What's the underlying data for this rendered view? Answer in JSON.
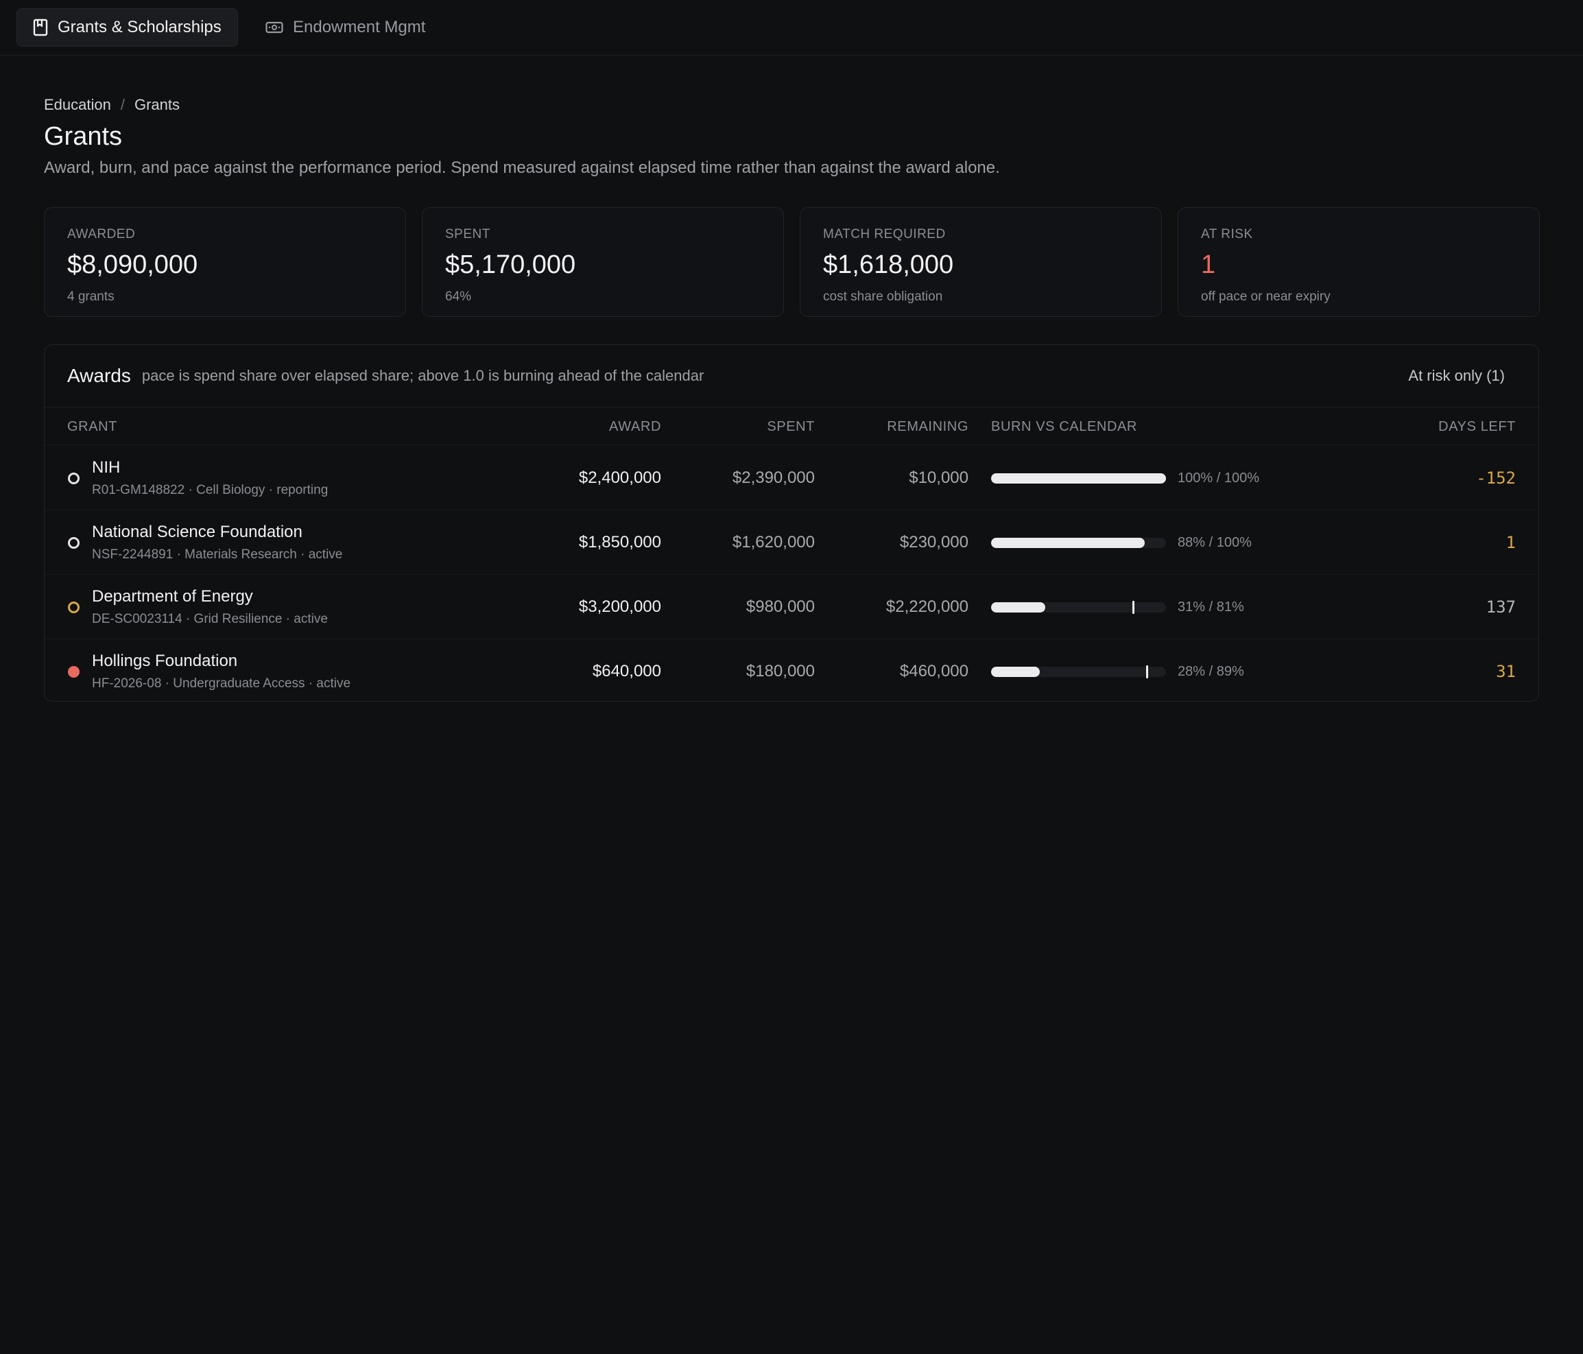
{
  "tabs": [
    {
      "label": "Grants & Scholarships",
      "icon": "bookmark-book-icon",
      "active": true
    },
    {
      "label": "Endowment Mgmt",
      "icon": "banknote-icon",
      "active": false
    }
  ],
  "breadcrumb": {
    "parent": "Education",
    "separator": "/",
    "current": "Grants"
  },
  "page": {
    "title": "Grants",
    "subtitle": "Award, burn, and pace against the performance period. Spend measured against elapsed time rather than against the award alone."
  },
  "kpis": [
    {
      "label": "AWARDED",
      "value": "$8,090,000",
      "sub": "4 grants"
    },
    {
      "label": "SPENT",
      "value": "$5,170,000",
      "sub": "64%"
    },
    {
      "label": "MATCH REQUIRED",
      "value": "$1,618,000",
      "sub": "cost share obligation"
    },
    {
      "label": "AT RISK",
      "value": "1",
      "sub": "off pace or near expiry"
    }
  ],
  "awards": {
    "title": "Awards",
    "note": "pace is spend share over elapsed share; above 1.0 is burning ahead of the calendar",
    "filter_label": "At risk only (1)",
    "columns": {
      "grant": "GRANT",
      "award": "AWARD",
      "spent": "SPENT",
      "remaining": "REMAINING",
      "burn": "BURN VS CALENDAR",
      "days": "DAYS LEFT"
    },
    "rows": [
      {
        "name": "NIH",
        "meta": "R01-GM148822 · Cell Biology · reporting",
        "award": "$2,400,000",
        "spent": "$2,390,000",
        "remaining": "$10,000",
        "burn_fraction": 1.0,
        "elapsed_fraction": 1.0,
        "burn_label": "100% / 100%",
        "days_left": "-152",
        "status": "neutral",
        "days_tone": "warn"
      },
      {
        "name": "National Science Foundation",
        "meta": "NSF-2244891 · Materials Research · active",
        "award": "$1,850,000",
        "spent": "$1,620,000",
        "remaining": "$230,000",
        "burn_fraction": 0.88,
        "elapsed_fraction": 1.0,
        "burn_label": "88% / 100%",
        "days_left": "1",
        "status": "neutral",
        "days_tone": "warn"
      },
      {
        "name": "Department of Energy",
        "meta": "DE-SC0023114 · Grid Resilience · active",
        "award": "$3,200,000",
        "spent": "$980,000",
        "remaining": "$2,220,000",
        "burn_fraction": 0.31,
        "elapsed_fraction": 0.81,
        "burn_label": "31% / 81%",
        "days_left": "137",
        "status": "warn",
        "days_tone": "neutral"
      },
      {
        "name": "Hollings Foundation",
        "meta": "HF-2026-08 · Undergraduate Access · active",
        "award": "$640,000",
        "spent": "$180,000",
        "remaining": "$460,000",
        "burn_fraction": 0.28,
        "elapsed_fraction": 0.89,
        "burn_label": "28% / 89%",
        "days_left": "31",
        "status": "risk",
        "days_tone": "warn"
      }
    ]
  },
  "colors": {
    "accent_risk": "#e86a5f",
    "accent_warn": "#d9a845",
    "background": "#0f1012"
  }
}
